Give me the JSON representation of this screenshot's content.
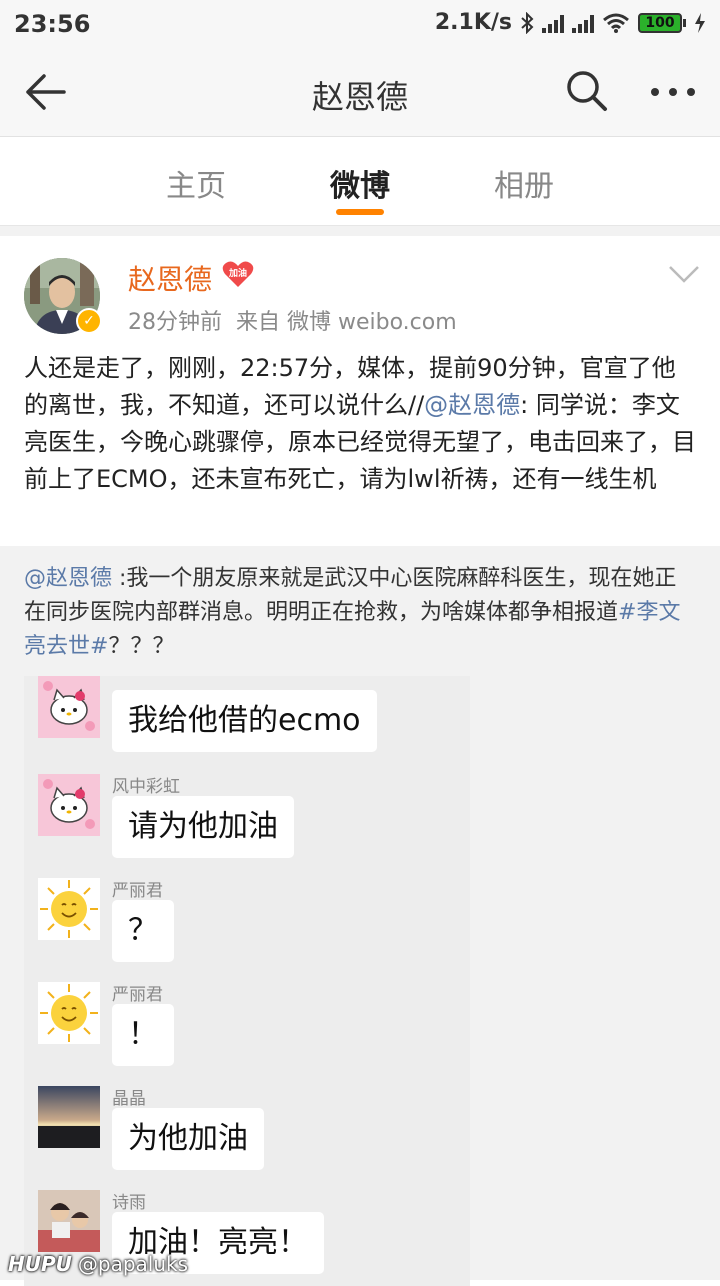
{
  "status_bar": {
    "time": "23:56",
    "speed": "2.1K/s",
    "battery": "100"
  },
  "nav": {
    "title": "赵恩德"
  },
  "tabs": [
    {
      "label": "主页",
      "active": false
    },
    {
      "label": "微博",
      "active": true
    },
    {
      "label": "相册",
      "active": false
    }
  ],
  "post": {
    "author": "赵恩德",
    "badge": "加油",
    "time_ago": "28分钟前",
    "source": "来自 微博 weibo.com",
    "text_part1": "人还是走了，刚刚，22:57分，媒体，提前90分钟，官宣了他的离世，我，不知道，还可以说什么//",
    "text_mention": "@赵恩德",
    "text_part2": ": 同学说：李文亮医生，今晚心跳骤停，原本已经觉得无望了，电击回来了，目前上了ECMO，还未宣布死亡，请为lwl祈祷，还有一线生机"
  },
  "retweet": {
    "mention": "@赵恩德",
    "text": " :我一个朋友原来就是武汉中心医院麻醉科医生，现在她正在同步医院内部群消息。明明正在抢救，为啥媒体都争相报道",
    "hashtag": "#李文亮去世#",
    "suffix": "？？？"
  },
  "chat": {
    "messages": [
      {
        "sender": "风中彩虹",
        "text": "我给他借的ecmo",
        "avatar": "hello-kitty"
      },
      {
        "sender": "风中彩虹",
        "text": "请为他加油",
        "avatar": "hello-kitty"
      },
      {
        "sender": "严丽君",
        "text": "？",
        "avatar": "sun"
      },
      {
        "sender": "严丽君",
        "text": "！",
        "avatar": "sun"
      },
      {
        "sender": "晶晶",
        "text": "为他加油",
        "avatar": "sunset"
      },
      {
        "sender": "诗雨",
        "text": "加油！亮亮！",
        "avatar": "photo"
      }
    ]
  },
  "watermark": {
    "brand": "HUPU",
    "handle": "@papaluks"
  },
  "colors": {
    "accent": "#ff8200",
    "name": "#e8681e",
    "link": "#5b7aa8"
  }
}
